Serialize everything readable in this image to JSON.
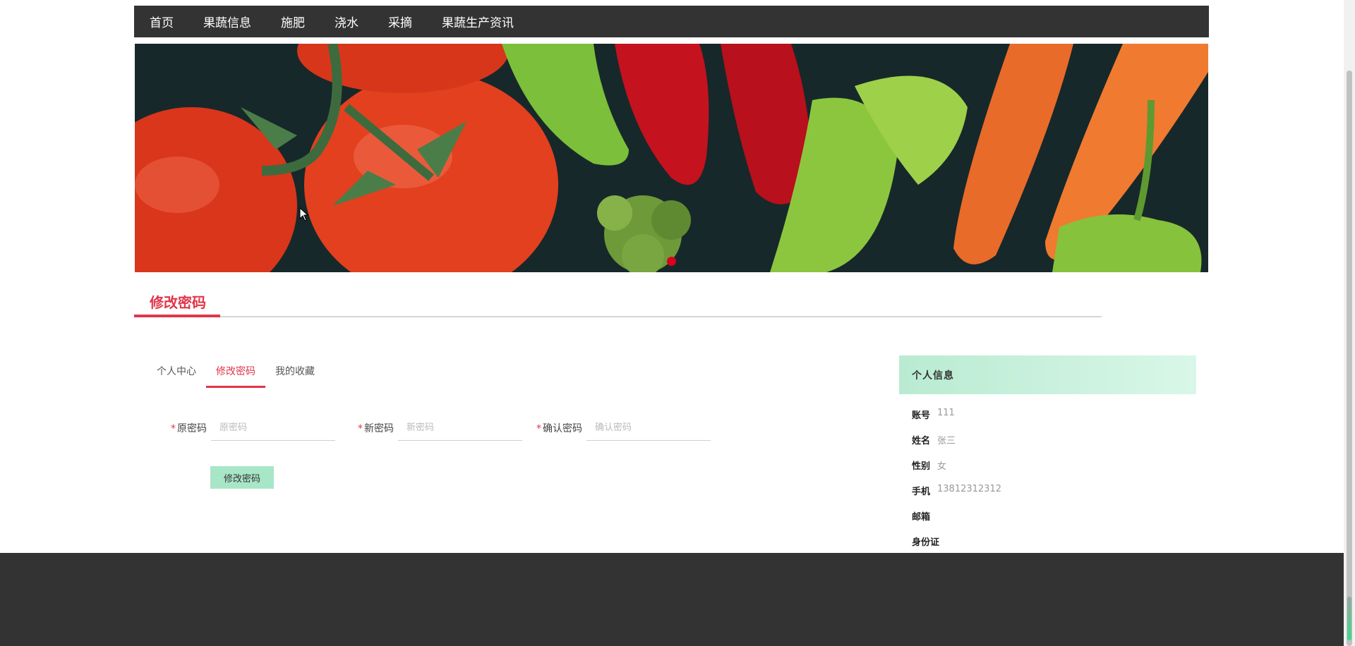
{
  "nav": {
    "items": [
      "首页",
      "果蔬信息",
      "施肥",
      "浇水",
      "采摘",
      "果蔬生产资讯"
    ]
  },
  "section": {
    "title": "修改密码"
  },
  "tabs": [
    {
      "label": "个人中心",
      "active": false
    },
    {
      "label": "修改密码",
      "active": true
    },
    {
      "label": "我的收藏",
      "active": false
    }
  ],
  "form": {
    "old_password": {
      "label": "原密码",
      "placeholder": "原密码"
    },
    "new_password": {
      "label": "新密码",
      "placeholder": "新密码"
    },
    "confirm_password": {
      "label": "确认密码",
      "placeholder": "确认密码"
    },
    "submit_label": "修改密码",
    "required_mark": "*"
  },
  "profile": {
    "header": "个人信息",
    "rows": [
      {
        "key": "账号",
        "value": "111"
      },
      {
        "key": "姓名",
        "value": "张三"
      },
      {
        "key": "性别",
        "value": "女"
      },
      {
        "key": "手机",
        "value": "13812312312"
      },
      {
        "key": "邮箱",
        "value": ""
      },
      {
        "key": "身份证",
        "value": ""
      }
    ]
  },
  "colors": {
    "accent": "#e0364a",
    "nav_bg": "#333333",
    "button_bg": "#a8e6c8",
    "panel_header": "#c8f0dc"
  }
}
